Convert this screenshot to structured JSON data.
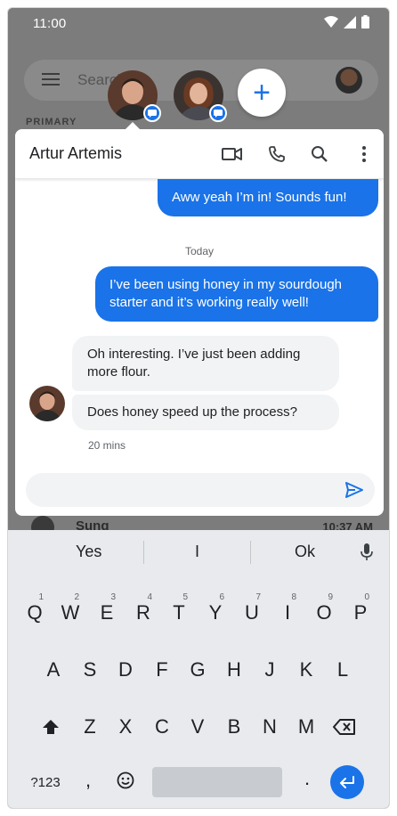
{
  "status_bar": {
    "time": "11:00"
  },
  "background_app": {
    "search_placeholder": "Search",
    "section_label": "PRIMARY",
    "row_sender": "Sung",
    "row_time": "10:37 AM"
  },
  "bubbles": {
    "new_label": "+"
  },
  "conversation": {
    "title": "Artur Artemis",
    "messages": [
      {
        "direction": "outgoing",
        "text": "Aww yeah I’m in! Sounds fun!"
      },
      {
        "direction": "outgoing",
        "text": "I’ve been using honey in my sourdough starter and it’s working really well!"
      },
      {
        "direction": "incoming",
        "text": "Oh interesting. I’ve just been adding more flour."
      },
      {
        "direction": "incoming",
        "text": "Does honey speed up the process?"
      }
    ],
    "date_separator": "Today",
    "timestamp": "20 mins",
    "compose_placeholder": ""
  },
  "keyboard": {
    "suggestions": [
      "Yes",
      "I",
      "Ok"
    ],
    "row1": [
      {
        "key": "Q",
        "num": "1"
      },
      {
        "key": "W",
        "num": "2"
      },
      {
        "key": "E",
        "num": "3"
      },
      {
        "key": "R",
        "num": "4"
      },
      {
        "key": "T",
        "num": "5"
      },
      {
        "key": "Y",
        "num": "6"
      },
      {
        "key": "U",
        "num": "7"
      },
      {
        "key": "I",
        "num": "8"
      },
      {
        "key": "O",
        "num": "9"
      },
      {
        "key": "P",
        "num": "0"
      }
    ],
    "row2": [
      "A",
      "S",
      "D",
      "F",
      "G",
      "H",
      "J",
      "K",
      "L"
    ],
    "row3": [
      "Z",
      "X",
      "C",
      "V",
      "B",
      "N",
      "M"
    ],
    "symbols_key": "?123",
    "comma_key": ",",
    "period_key": "."
  },
  "colors": {
    "accent": "#1a73e8",
    "scrim": "#7c7c7c",
    "incoming_bubble": "#f1f3f4",
    "keyboard_bg": "#e8eaed"
  }
}
